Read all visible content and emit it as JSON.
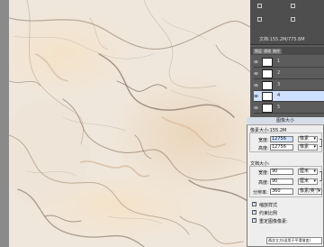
{
  "info": {
    "document_size": "文档:155.2M/775.6M"
  },
  "layers": {
    "tabs": [
      "图层",
      "通道",
      "路径"
    ],
    "rows": [
      {
        "name": "1"
      },
      {
        "name": "2"
      },
      {
        "name": "3"
      },
      {
        "name": "4"
      },
      {
        "name": "5"
      }
    ]
  },
  "dialog": {
    "title": "图像大小",
    "pixel_dimensions_label": "像素大小:155.2M",
    "pixel_width_label": "宽度:",
    "pixel_width_value": "12756",
    "pixel_width_unit": "像素",
    "pixel_height_label": "高度:",
    "pixel_height_value": "12756",
    "pixel_height_unit": "像素",
    "document_size_label": "文档大小:",
    "doc_width_label": "宽度:",
    "doc_width_value": "90",
    "doc_width_unit": "厘米",
    "doc_height_label": "高度:",
    "doc_height_value": "90",
    "doc_height_unit": "厘米",
    "resolution_label": "分辨率:",
    "resolution_value": "360",
    "resolution_unit": "像素/英寸",
    "scale_styles_label": "缩放样式",
    "constrain_label": "约束比例",
    "resample_label": "重定图像像素:",
    "resample_method": "两次立方(适用于平滑渐变)"
  },
  "colors": {
    "canvas_bg": "#efe6da",
    "panel_dark": "#5a5a5a",
    "dialog_bg": "#eeeeee",
    "active_layer": "#cfe0ff"
  }
}
